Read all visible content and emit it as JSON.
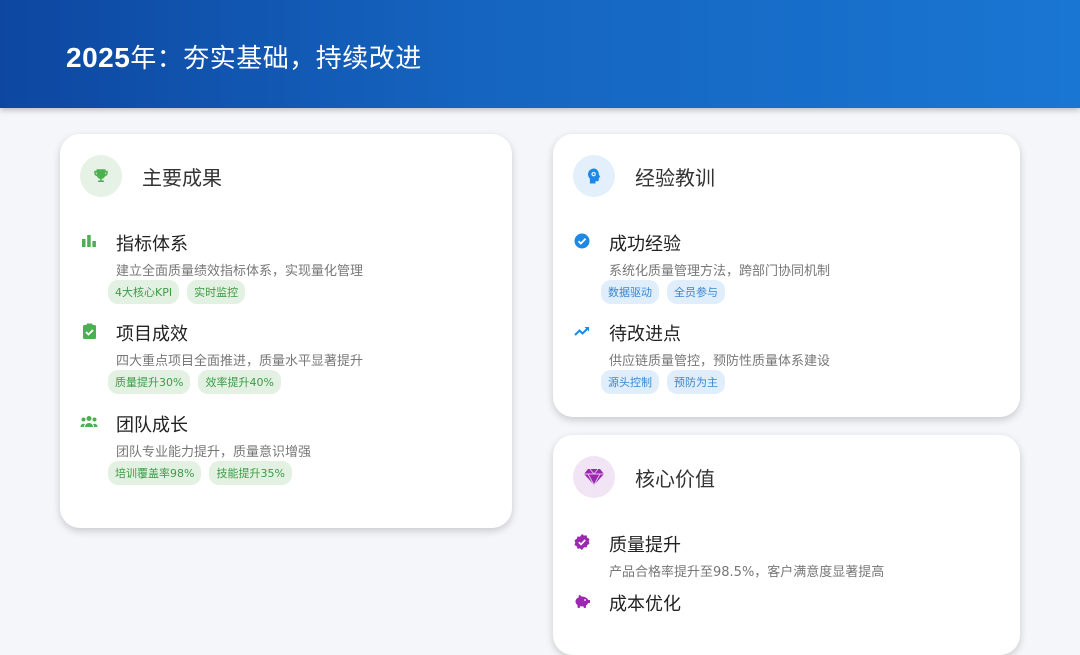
{
  "header": {
    "year": "2025",
    "title_rest": "年：夯实基础，持续改进"
  },
  "achievements": {
    "title": "主要成果",
    "icon": "trophy-icon",
    "items": [
      {
        "icon": "bar-chart-icon",
        "title": "指标体系",
        "desc": "建立全面质量绩效指标体系，实现量化管理",
        "tags": [
          "4大核心KPI",
          "实时监控"
        ]
      },
      {
        "icon": "clipboard-check-icon",
        "title": "项目成效",
        "desc": "四大重点项目全面推进，质量水平显著提升",
        "tags": [
          "质量提升30%",
          "效率提升40%"
        ]
      },
      {
        "icon": "team-icon",
        "title": "团队成长",
        "desc": "团队专业能力提升，质量意识增强",
        "tags": [
          "培训覆盖率98%",
          "技能提升35%"
        ]
      }
    ]
  },
  "lessons": {
    "title": "经验教训",
    "icon": "head-gear-icon",
    "items": [
      {
        "icon": "check-circle-icon",
        "title": "成功经验",
        "desc": "系统化质量管理方法，跨部门协同机制",
        "tags": [
          "数据驱动",
          "全员参与"
        ]
      },
      {
        "icon": "trend-up-icon",
        "title": "待改进点",
        "desc": "供应链质量管控，预防性质量体系建设",
        "tags": [
          "源头控制",
          "预防为主"
        ]
      }
    ]
  },
  "values": {
    "title": "核心价值",
    "icon": "gem-icon",
    "items": [
      {
        "icon": "badge-check-icon",
        "title": "质量提升",
        "desc": "产品合格率提升至98.5%，客户满意度显著提高"
      },
      {
        "icon": "piggy-bank-icon",
        "title": "成本优化",
        "desc": ""
      }
    ]
  },
  "colors": {
    "green": "#4caf50",
    "blue": "#1e88e5",
    "purple": "#9c27b0",
    "header": "#1565c0"
  }
}
